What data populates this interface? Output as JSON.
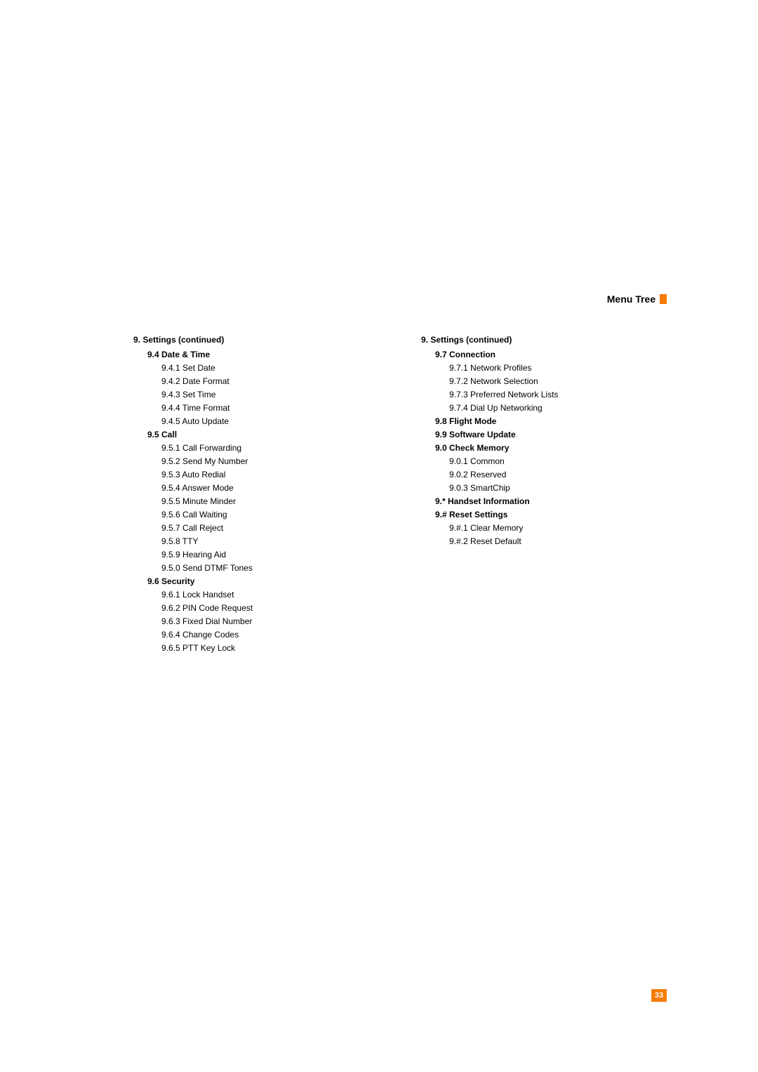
{
  "header": {
    "title": "Menu Tree"
  },
  "page_number": "33",
  "left": {
    "heading": "9.  Settings (continued)",
    "sections": [
      {
        "title": "9.4 Date & Time",
        "items": [
          "9.4.1 Set Date",
          "9.4.2 Date Format",
          "9.4.3 Set Time",
          "9.4.4 Time Format",
          "9.4.5 Auto Update"
        ]
      },
      {
        "title": "9.5 Call",
        "items": [
          "9.5.1 Call Forwarding",
          "9.5.2 Send My Number",
          "9.5.3 Auto Redial",
          "9.5.4 Answer Mode",
          "9.5.5 Minute Minder",
          "9.5.6 Call Waiting",
          "9.5.7 Call Reject",
          "9.5.8 TTY",
          "9.5.9 Hearing Aid",
          "9.5.0 Send DTMF Tones"
        ]
      },
      {
        "title": "9.6 Security",
        "items": [
          "9.6.1 Lock Handset",
          "9.6.2 PIN Code Request",
          "9.6.3 Fixed Dial Number",
          "9.6.4 Change Codes",
          "9.6.5 PTT Key Lock"
        ]
      }
    ]
  },
  "right": {
    "heading": "9.  Settings (continued)",
    "sections": [
      {
        "title": "9.7 Connection",
        "items": [
          "9.7.1 Network Profiles",
          "9.7.2 Network Selection",
          "9.7.3 Preferred Network Lists",
          "9.7.4 Dial Up Networking"
        ]
      },
      {
        "title": "9.8 Flight Mode",
        "items": []
      },
      {
        "title": "9.9 Software Update",
        "items": []
      },
      {
        "title": "9.0 Check Memory",
        "items": [
          "9.0.1 Common",
          "9.0.2 Reserved",
          "9.0.3 SmartChip"
        ]
      },
      {
        "title": "9.* Handset Information",
        "items": []
      },
      {
        "title": "9.# Reset Settings",
        "items": [
          "9.#.1 Clear Memory",
          "9.#.2 Reset Default"
        ]
      }
    ]
  }
}
